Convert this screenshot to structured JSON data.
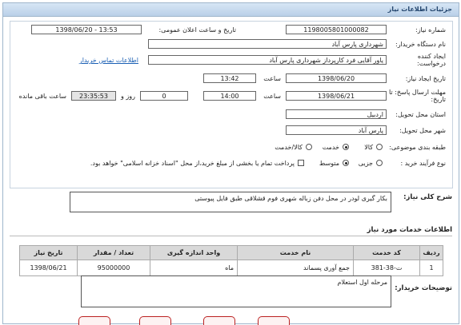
{
  "header": {
    "title": "جزئیات اطلاعات نیاز"
  },
  "fields": {
    "need_number_label": "شماره نیاز:",
    "need_number": "1198005801000082",
    "announce_label": "تاریخ و ساعت اعلان عمومی:",
    "announce_value": "1398/06/20 - 13:53",
    "org_label": "نام دستگاه خریدار:",
    "org_value": "شهرداری پارس آباد",
    "creator_label_1": "ایجاد کننده",
    "creator_label_2": "درخواست:",
    "creator_value": "یاور آقایی فرد کارپرداز شهرداری پارس آباد",
    "contact_link": "اطلاعات تماس خریدار",
    "created_date_label": "تاریخ ایجاد نیاز:",
    "created_date": "1398/06/20",
    "time_label": "ساعت",
    "created_time": "13:42",
    "deadline_label_1": "مهلت ارسال پاسخ: تا",
    "deadline_label_2": "تاریخ:",
    "deadline_date": "1398/06/21",
    "deadline_time": "14:00",
    "day_label": "روز و",
    "days_value": "0",
    "remaining_time": "23:35:53",
    "remaining_label": "ساعت باقی مانده",
    "province_label": "استان محل تحویل:",
    "province_value": "اردبیل",
    "city_label": "شهر محل تحویل:",
    "city_value": "پارس آباد",
    "category_label": "طبقه بندی موضوعی:",
    "category_options": [
      "کالا",
      "خدمت",
      "کالا/خدمت"
    ],
    "category_selected": "خدمت",
    "purchase_type_label": "نوع فرآیند خرید :",
    "purchase_options": [
      "جزیی",
      "متوسط"
    ],
    "purchase_selected": "متوسط",
    "payment_note": "پرداخت تمام یا بخشی از مبلغ خرید،از محل \"اسناد خزانه اسلامی\" خواهد بود."
  },
  "summary": {
    "label": "شرح کلی نیاز:",
    "text": "بکار گیری لودر در محل دفن زباله شهری فوم قشلاقی طبق فایل پیوستی"
  },
  "services": {
    "section_title": "اطلاعات خدمات مورد نیاز",
    "columns": [
      "ردیف",
      "کد خدمت",
      "نام خدمت",
      "واحد اندازه گیری",
      "تعداد / مقدار",
      "تاریخ نیاز"
    ],
    "rows": [
      {
        "row": "1",
        "code": "ت-38-381",
        "name": "جمع آوری پسماند",
        "unit": "ماه",
        "qty": "95000000",
        "date": "1398/06/21"
      }
    ]
  },
  "buyer_notes": {
    "label": "توضیحات خریدار:",
    "text": "مرحله اول استعلام"
  },
  "colors": {
    "header_bg": "#c4d8ee",
    "link": "#1a5fb4",
    "table_head": "#d9d9d9"
  }
}
